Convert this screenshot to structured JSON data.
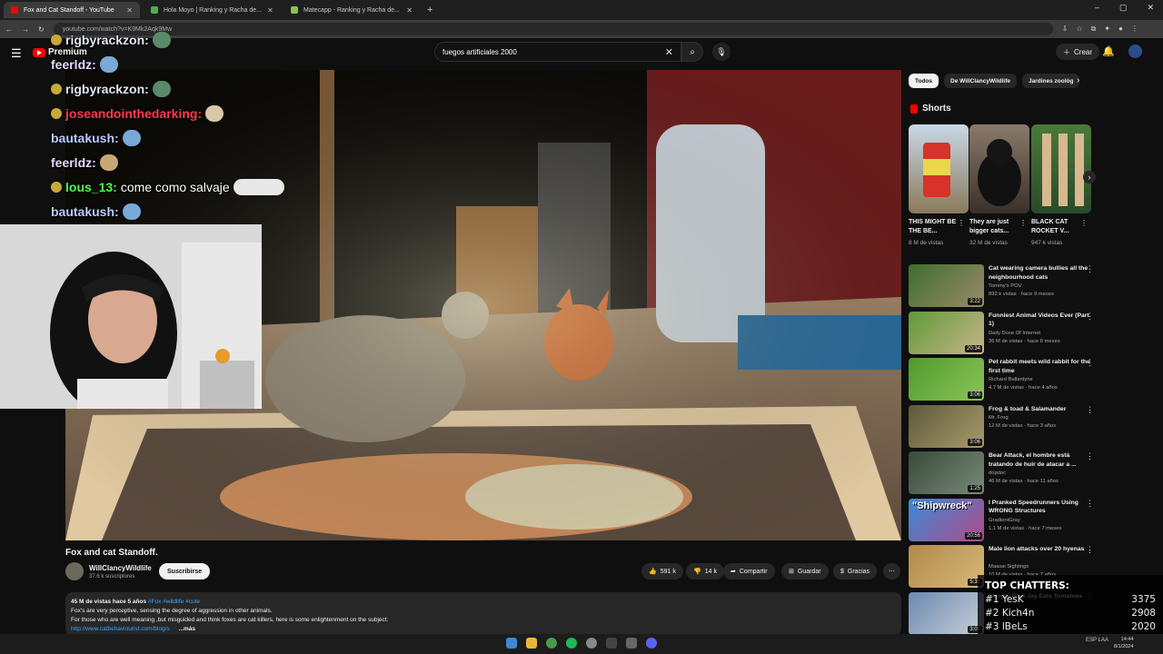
{
  "browser": {
    "tabs": [
      {
        "title": "Fox and Cat Standoff - YouTube",
        "color": "#ff0000"
      },
      {
        "title": "Hola Moyo | Ranking y Racha de...",
        "color": "#4caf50"
      },
      {
        "title": "Matecapp - Ranking y Racha de...",
        "color": "#8bc34a"
      }
    ],
    "url": "youtube.com/watch?v=K9Mk2Aqk9Mw",
    "new_tab": "+",
    "window_controls": [
      "–",
      "▢",
      "✕"
    ]
  },
  "header": {
    "brand": "Premium",
    "search_value": "fuegos artificiales 2000",
    "create_label": "Crear"
  },
  "overlay": {
    "chat": [
      {
        "user": "rigbyrackzon:",
        "text": "",
        "color": "#dfe8f2",
        "badge": true
      },
      {
        "user": "feerldz:",
        "text": "",
        "color": "#e8d8ff",
        "badge": false
      },
      {
        "user": "rigbyrackzon:",
        "text": "",
        "color": "#dfe8f2",
        "badge": true
      },
      {
        "user": "joseandointhedarking:",
        "text": "",
        "color": "#ff3b4b",
        "badge": true
      },
      {
        "user": "bautakush:",
        "text": "",
        "color": "#b8ccff",
        "badge": false
      },
      {
        "user": "feerldz:",
        "text": "",
        "color": "#e8d8ff",
        "badge": false
      },
      {
        "user": "lous_13:",
        "text": "come como salvaje",
        "color": "#52ff4a",
        "badge": true
      },
      {
        "user": "bautakush:",
        "text": "",
        "color": "#b8ccff",
        "badge": false
      }
    ],
    "top_chatters": {
      "title": "TOP CHATTERS:",
      "rows": [
        {
          "rank": "#1",
          "name": "YesK",
          "count": "3375"
        },
        {
          "rank": "#2",
          "name": "Kich4n",
          "count": "2908"
        },
        {
          "rank": "#3",
          "name": "lBeLs",
          "count": "2020"
        }
      ]
    }
  },
  "video": {
    "title": "Fox and cat Standoff.",
    "channel": "WillClancyWildlife",
    "subscribers": "37.6 k suscriptores",
    "subscribe_label": "Suscribirse",
    "likes": "591 k",
    "dislikes": "14 k",
    "share_label": "Compartir",
    "save_label": "Guardar",
    "thanks_label": "Gracias",
    "description": {
      "meta": "45 M de vistas  hace 5 años",
      "tags": "#Fox #wildlife #cute",
      "line1": "Fox's are very perceptive, sensing the degree of aggression in other animals.",
      "line2": "For those who are well meaning ,but misguided and think foxes are cat killers, here is some enlightenment on the subject:",
      "link": "http://www.catbehaviourist.com/blog/s",
      "more": "...más"
    }
  },
  "sidebar": {
    "chips": [
      "Todos",
      "De WillClancyWildlife",
      "Jardines zoológ"
    ],
    "shorts_title": "Shorts",
    "shorts": [
      {
        "title": "THIS MIGHT BE THE BE...",
        "views": "8 M de vistas"
      },
      {
        "title": "They are just bigger cats...",
        "views": "32 M de vistas"
      },
      {
        "title": "BLACK CAT ROCKET V...",
        "views": "947 k vistas"
      }
    ],
    "recommended": [
      {
        "title": "Cat wearing camera bullies all the neighbourhood cats",
        "channel": "Tommy's POV",
        "meta": "892 k vistas · hace 9 meses",
        "duration": "3:22",
        "c1": "#3f6e2e",
        "c2": "#9a8a6a"
      },
      {
        "title": "Funniest Animal Videos Ever (Part 1)",
        "channel": "Daily Dose Of Internet",
        "meta": "36 M de vistas · hace 8 meses",
        "duration": "20:34",
        "c1": "#5f9a38",
        "c2": "#c8b48a"
      },
      {
        "title": "Pet rabbit meets wild rabbit for the first time",
        "channel": "Richard Ballantyne",
        "meta": "4.7 M de vistas · hace 4 años",
        "duration": "3:06",
        "c1": "#4f9a2c",
        "c2": "#8cc45a"
      },
      {
        "title": "Frog & toad & Salamander",
        "channel": "Mr. Frog",
        "meta": "12 M de vistas · hace 3 años",
        "duration": "3:06",
        "c1": "#5d5a3a",
        "c2": "#a89a6a"
      },
      {
        "title": "Bear Attack, el hombre está tratando de huir de atacar a ...",
        "channel": "dopdoc",
        "meta": "46 M de vistas · hace 11 años",
        "duration": "1:25",
        "c1": "#3a4a3a",
        "c2": "#7a8a7a"
      },
      {
        "title": "I Pranked Speedrunners Using WRONG Structures",
        "channel": "GradientGray",
        "meta": "1.1 M de vistas · hace 7 meses",
        "duration": "20:56",
        "c1": "#3a8ad6",
        "c2": "#b04a8a"
      },
      {
        "title": "Male lion attacks over 20 hyenas",
        "channel": "Maasai Sightings",
        "meta": "10 M de vistas · hace 7 años",
        "duration": "5:31",
        "c1": "#b08a4a",
        "c2": "#d8b87a"
      },
      {
        "title": "Hungry Blue Jay Eats Tomatoes",
        "channel": "",
        "meta": "",
        "duration": "3:01",
        "c1": "#6a8ab0",
        "c2": "#c8d0d8"
      }
    ],
    "shipwreck_label": "\"Shipwreck\""
  },
  "taskbar": {
    "lang": "ESP LAA",
    "time": "14:44",
    "date": "8/1/2024"
  }
}
